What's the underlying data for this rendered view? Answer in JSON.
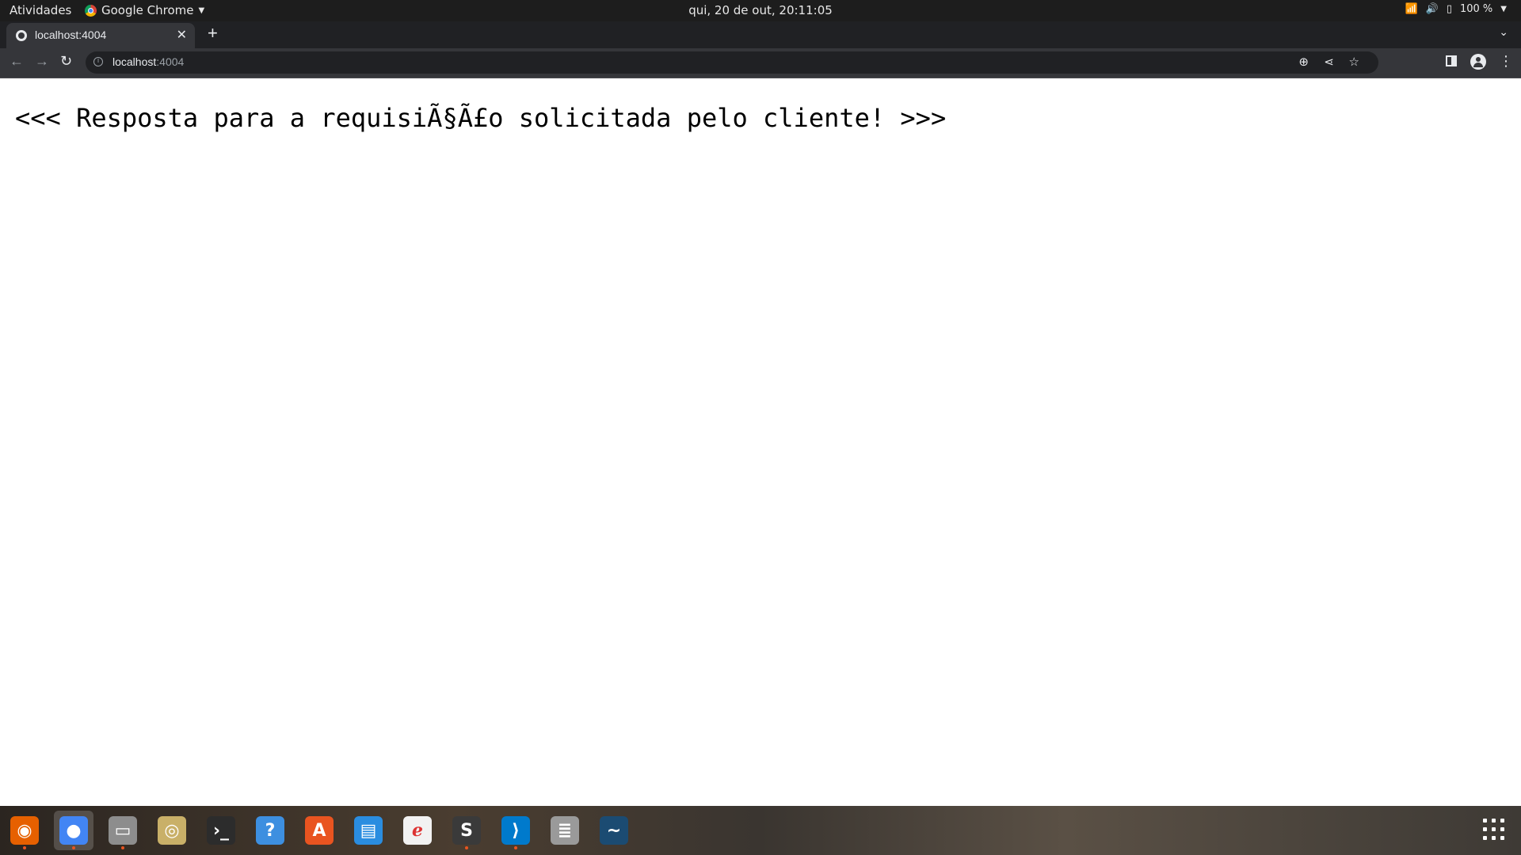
{
  "topbar": {
    "activities": "Atividades",
    "app_name": "Google Chrome",
    "clock": "qui, 20 de out, 20:11:05",
    "battery": "100 %"
  },
  "browser": {
    "tab_title": "localhost:4004",
    "url_host": "localhost",
    "url_port": ":4004"
  },
  "page": {
    "response_text": "<<< Resposta para a requisiÃ§Ã£o solicitada pelo cliente! >>>"
  },
  "dock": {
    "apps": [
      {
        "name": "firefox",
        "color": "#e66000"
      },
      {
        "name": "chrome",
        "color": "#4285f4"
      },
      {
        "name": "files",
        "color": "#8d8d8d"
      },
      {
        "name": "rhythmbox",
        "color": "#c9b068"
      },
      {
        "name": "terminal",
        "color": "#2c2c2c"
      },
      {
        "name": "help",
        "color": "#3d8fe0"
      },
      {
        "name": "software",
        "color": "#e95420"
      },
      {
        "name": "writer",
        "color": "#2a8de0"
      },
      {
        "name": "pdf-viewer",
        "color": "#f2f2f2"
      },
      {
        "name": "sublime-text",
        "color": "#3a3a3a"
      },
      {
        "name": "vscode",
        "color": "#007acc"
      },
      {
        "name": "database",
        "color": "#9a9a9a"
      },
      {
        "name": "mysql-workbench",
        "color": "#1b4b72"
      }
    ]
  }
}
